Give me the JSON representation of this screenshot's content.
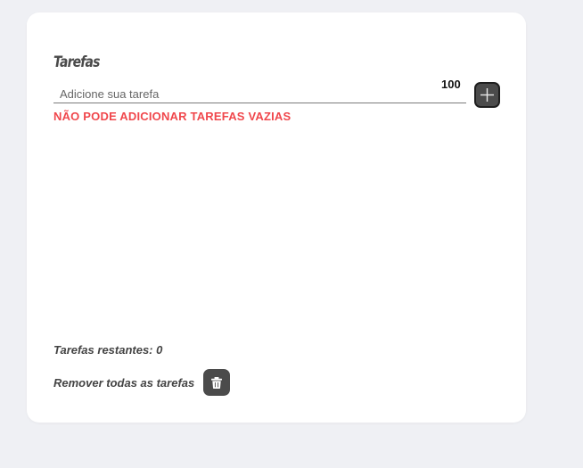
{
  "card": {
    "title": "Tarefas",
    "char_counter": "100",
    "input": {
      "placeholder": "Adicione sua tarefa",
      "value": ""
    },
    "add_button_icon": "plus-icon",
    "error_message": "NÃO PODE ADICIONAR TAREFAS VAZIAS",
    "remaining_label": "Tarefas restantes: 0",
    "remove_all_label": "Remover todas as tarefas",
    "remove_button_icon": "trash-icon"
  },
  "colors": {
    "background": "#eff0f4",
    "card": "#ffffff",
    "error": "#f0474c",
    "button": "#4b4b4b",
    "text": "#444444"
  }
}
